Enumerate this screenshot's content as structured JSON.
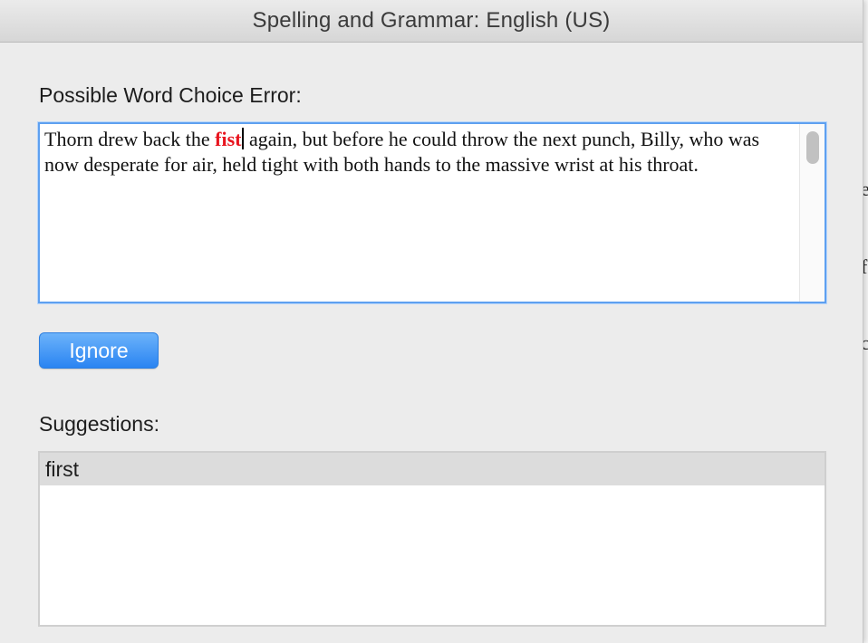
{
  "window": {
    "title": "Spelling and Grammar: English (US)"
  },
  "error_section": {
    "label": "Possible Word Choice Error:",
    "text_before": "Thorn drew back the ",
    "error_word": "fist",
    "text_after": " again, but before he could throw the next punch, Billy, who was now desperate for air, held tight with both hands to the massive wrist at his throat.",
    "error_color": "#e8141e"
  },
  "buttons": {
    "ignore_label": "Ignore"
  },
  "suggestions": {
    "label": "Suggestions:",
    "items": [
      "first"
    ]
  },
  "colors": {
    "accent": "#2a84f2",
    "focus_ring": "#5ea0f0",
    "selected_row": "#dcdcdc"
  }
}
